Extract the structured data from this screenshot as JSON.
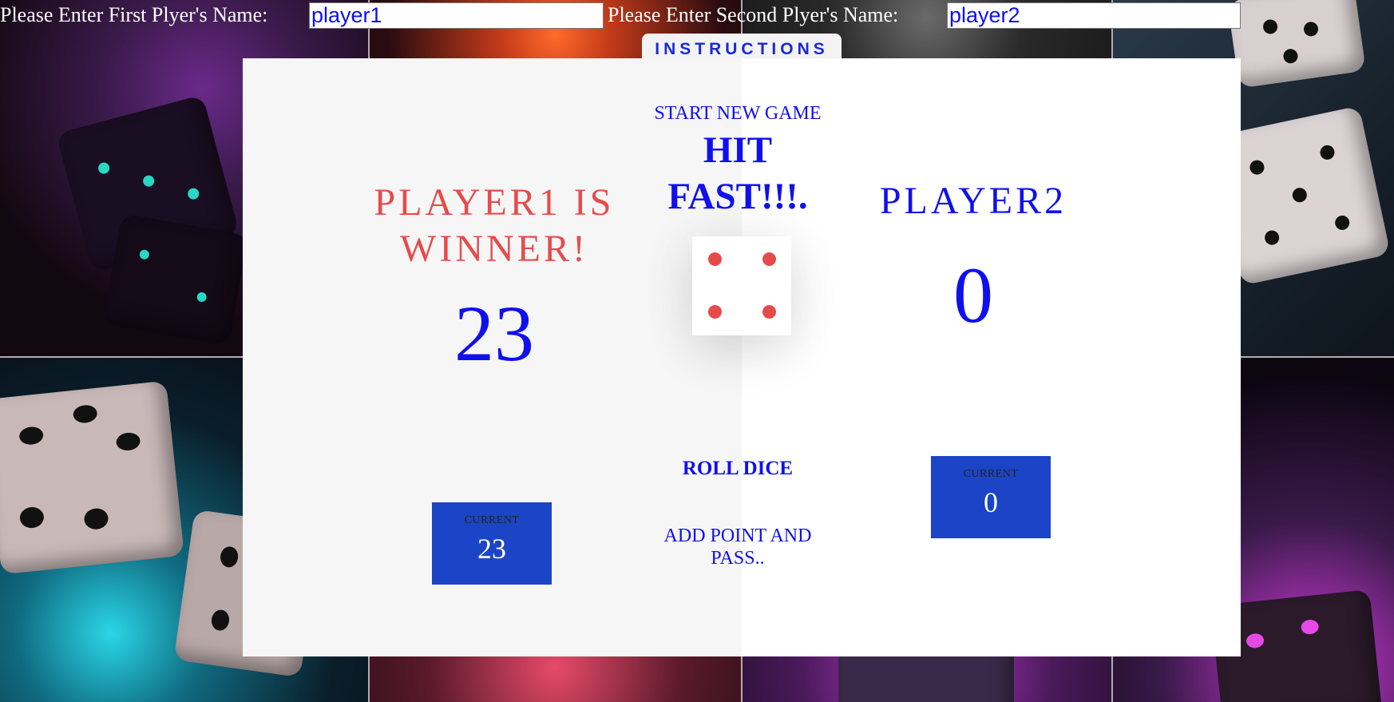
{
  "names": {
    "player1_label": "Please Enter First Plyer's Name:",
    "player1_value": "player1",
    "player2_label": "Please Enter Second Plyer's Name:",
    "player2_value": "player2"
  },
  "instructions_label": "INSTRUCTIONS",
  "controls": {
    "new_game_label": "START NEW GAME",
    "hit_fast_text": "HIT FAST!!!.",
    "roll_label": "ROLL DICE",
    "hold_label": "ADD POINT AND PASS.."
  },
  "dice": {
    "value": 4
  },
  "players": [
    {
      "name": "PLAYER1 IS WINNER!",
      "score": "23",
      "current_label": "CURRENT",
      "current_score": "23",
      "winner": true
    },
    {
      "name": "PLAYER2",
      "score": "0",
      "current_label": "CURRENT",
      "current_score": "0",
      "winner": false
    }
  ],
  "colors": {
    "accent_blue": "#1010ee",
    "winner_red": "#e64b4b",
    "current_box": "#1c44c6",
    "dice_dot": "#e64b4b"
  },
  "icons": {
    "dice": "dice-face-icon"
  }
}
